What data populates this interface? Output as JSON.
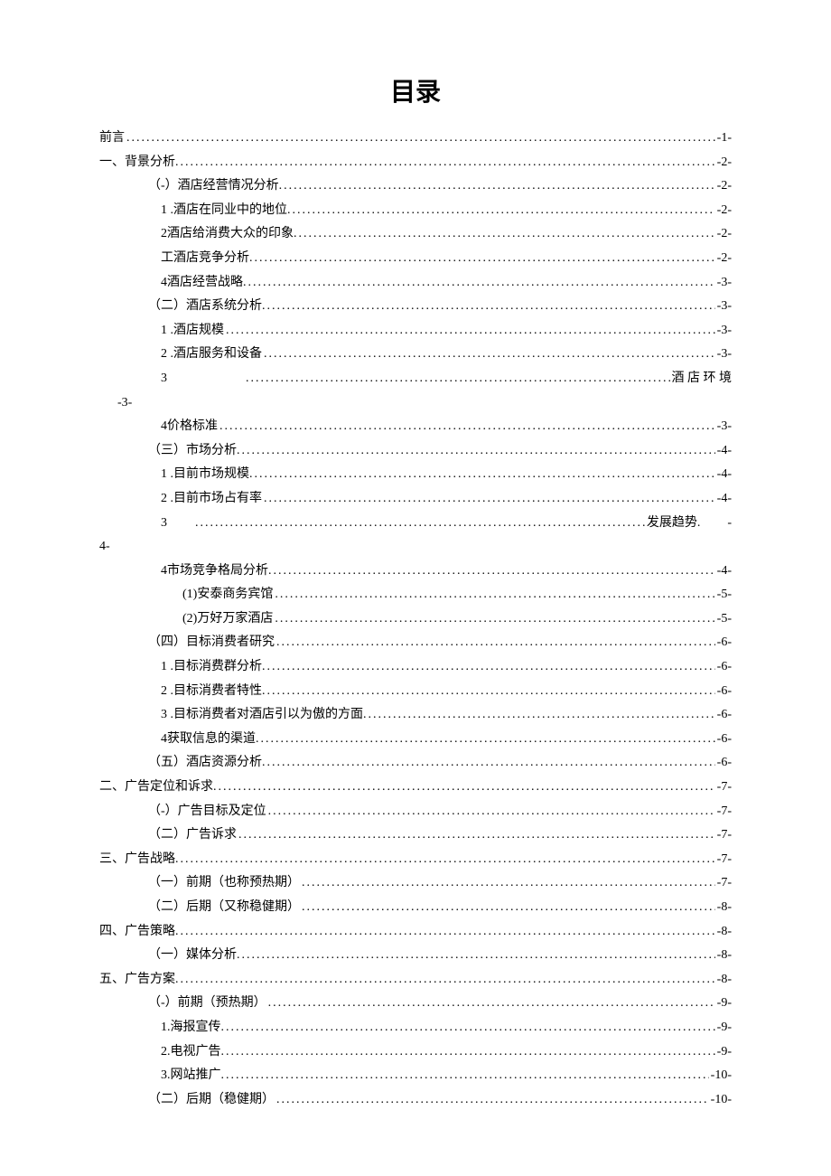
{
  "title": "目录",
  "dots": "..........................................................................................................................",
  "entries": [
    {
      "indent": 0,
      "prefix": "",
      "label": "前言",
      "page": "-1-"
    },
    {
      "indent": 0,
      "prefix": "一、",
      "label": "背景分析.",
      "page": "-2-"
    },
    {
      "indent": 1,
      "prefix": "（-）",
      "label": "酒店经营情况分析.",
      "page": "-2-"
    },
    {
      "indent": 2,
      "prefix": "1 .",
      "label": "酒店在同业中的地位.",
      "page": "-2-"
    },
    {
      "indent": 2,
      "prefix": "2   ",
      "label": "酒店给消费大众的印象.",
      "page": "-2-"
    },
    {
      "indent": 2,
      "prefix": "工  ",
      "label": "酒店竞争分析.",
      "page": "-2-"
    },
    {
      "indent": 2,
      "prefix": "4   ",
      "label": "酒店经营战略.",
      "page": "-3-"
    },
    {
      "indent": 1,
      "prefix": "（二）",
      "label": "酒店系统分析.",
      "page": "-3-"
    },
    {
      "indent": 2,
      "prefix": "1 .",
      "label": "酒店规模",
      "page": "-3-"
    },
    {
      "indent": 2,
      "prefix": "2 .",
      "label": "酒店服务和设备",
      "page": "-3-"
    },
    {
      "indent": 2,
      "prefix": "3",
      "label": "",
      "tail": "酒 店 环 境",
      "tailPage": "-3-",
      "special": "tail"
    },
    {
      "indent": 2,
      "prefix": "4   ",
      "label": "价格标准",
      "page": "-3-"
    },
    {
      "indent": 1,
      "prefix": "（三）",
      "label": "市场分析.",
      "page": "-4-"
    },
    {
      "indent": 2,
      "prefix": "1 .",
      "label": "目前市场规模.",
      "page": "-4-"
    },
    {
      "indent": 2,
      "prefix": "2 .",
      "label": "目前市场占有率",
      "page": "-4-"
    },
    {
      "indent": 2,
      "prefix": "3",
      "label": "",
      "tail": "发展趋势.",
      "tailPage": "4-",
      "tailDash": "-",
      "special": "tail2"
    },
    {
      "indent": 2,
      "prefix": "4   ",
      "label": "市场竞争格局分析.",
      "page": "-4-"
    },
    {
      "indent": 3,
      "prefix": "(1)   ",
      "label": "安泰商务宾馆",
      "page": "-5-"
    },
    {
      "indent": 3,
      "prefix": "(2)   ",
      "label": "万好万家酒店",
      "page": "-5-"
    },
    {
      "indent": 1,
      "prefix": "（四）",
      "label": "目标消费者研究",
      "page": "-6-"
    },
    {
      "indent": 2,
      "prefix": "1 .",
      "label": "目标消费群分析.",
      "page": "-6-"
    },
    {
      "indent": 2,
      "prefix": "2 .",
      "label": "目标消费者特性.",
      "page": "-6-"
    },
    {
      "indent": 2,
      "prefix": "3 .",
      "label": "目标消费者对酒店引以为傲的方面.",
      "page": "-6-"
    },
    {
      "indent": 2,
      "prefix": "4   ",
      "label": "获取信息的渠道.",
      "page": "-6-"
    },
    {
      "indent": 1,
      "prefix": "（五）",
      "label": "酒店资源分析.",
      "page": "-6-"
    },
    {
      "indent": 0,
      "prefix": "二、",
      "label": "广告定位和诉求.",
      "page": "-7-"
    },
    {
      "indent": 1,
      "prefix": "（-）",
      "label": "广告目标及定位",
      "page": "-7-"
    },
    {
      "indent": 1,
      "prefix": "（二）",
      "label": "广告诉求",
      "page": "-7-"
    },
    {
      "indent": 0,
      "prefix": "三、",
      "label": "广告战略.",
      "page": "-7-"
    },
    {
      "indent": 1,
      "prefix": "（一）",
      "label": "前期（也称预热期）",
      "page": "-7-"
    },
    {
      "indent": 1,
      "prefix": "（二）",
      "label": "后期（又称稳健期）",
      "page": "-8-"
    },
    {
      "indent": 0,
      "prefix": "四、",
      "label": "广告策略.",
      "page": "-8-"
    },
    {
      "indent": 1,
      "prefix": "（一）",
      "label": "媒体分析.",
      "page": "-8-"
    },
    {
      "indent": 0,
      "prefix": "五、",
      "label": "广告方案.",
      "page": "-8-"
    },
    {
      "indent": 1,
      "prefix": "（-）",
      "label": "前期（预热期）",
      "page": "-9-"
    },
    {
      "indent": 2,
      "prefix": "1.   ",
      "label": "海报宣传.",
      "page": "-9-"
    },
    {
      "indent": 2,
      "prefix": "2.   ",
      "label": "电视广告.",
      "page": "-9-"
    },
    {
      "indent": 2,
      "prefix": "3.   ",
      "label": "网站推广.",
      "page": "-10-"
    },
    {
      "indent": 1,
      "prefix": "（二）",
      "label": "后期（稳健期）",
      "page": "-10-"
    }
  ]
}
